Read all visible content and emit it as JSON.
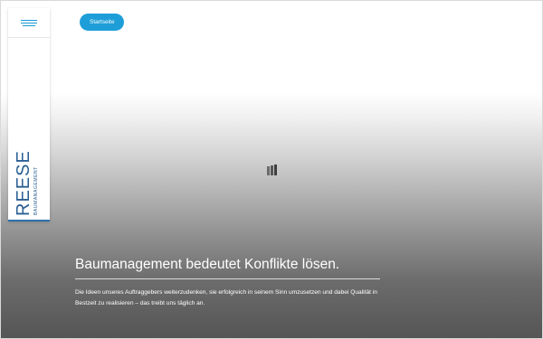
{
  "sidebar": {
    "logo": {
      "name": "REESE",
      "subtitle": "BAUMANAGEMENT"
    }
  },
  "header": {
    "home_button_label": "Startseite"
  },
  "hero": {
    "title": "Baumanagement bedeutet Konflikte lösen.",
    "text": "Die Ideen unseres Auftraggebers weiterzudenken, sie erfolgreich in seinem Sinn umzusetzen und dabei Qualität in Bestzeit zu realisieren – das treibt uns täglich an."
  },
  "colors": {
    "accent": "#1e9ed8",
    "logo": "#2b5f93",
    "logo_bottom_bar": "#2e6fb0"
  },
  "icons": {
    "menu": "hamburger-menu-icon",
    "loading": "loading-bars-icon"
  }
}
